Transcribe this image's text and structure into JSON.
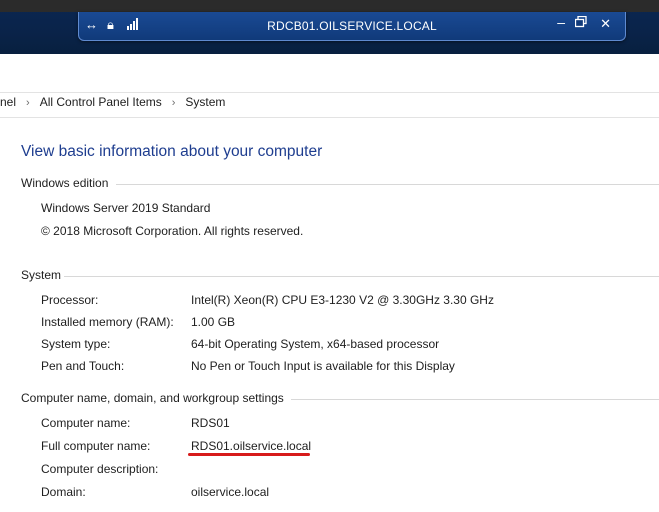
{
  "rdp_bar": {
    "title": "RDCB01.OILSERVICE.LOCAL",
    "icons": [
      "pin-icon",
      "lock-icon",
      "signal-icon"
    ],
    "controls": [
      "minimize",
      "restore",
      "close"
    ]
  },
  "breadcrumb": {
    "items": [
      "nel",
      "All Control Panel Items",
      "System"
    ]
  },
  "heading": "View basic information about your computer",
  "windows_edition": {
    "title": "Windows edition",
    "name": "Windows Server 2019 Standard",
    "copyright": "© 2018 Microsoft Corporation. All rights reserved."
  },
  "system": {
    "title": "System",
    "processor_label": "Processor:",
    "processor_value": "Intel(R) Xeon(R) CPU E3-1230 V2 @ 3.30GHz   3.30 GHz",
    "memory_label": "Installed memory (RAM):",
    "memory_value": "1.00 GB",
    "type_label": "System type:",
    "type_value": "64-bit Operating System, x64-based processor",
    "pen_label": "Pen and Touch:",
    "pen_value": "No Pen or Touch Input is available for this Display"
  },
  "computer_name": {
    "title": "Computer name, domain, and workgroup settings",
    "name_label": "Computer name:",
    "name_value": "RDS01",
    "full_label": "Full computer name:",
    "full_value": "RDS01.oilservice.local",
    "desc_label": "Computer description:",
    "desc_value": "",
    "domain_label": "Domain:",
    "domain_value": "oilservice.local"
  },
  "colors": {
    "heading": "#1e3d8f",
    "rdp_bar": "#1a4a94",
    "annotation": "#d71b1b"
  }
}
